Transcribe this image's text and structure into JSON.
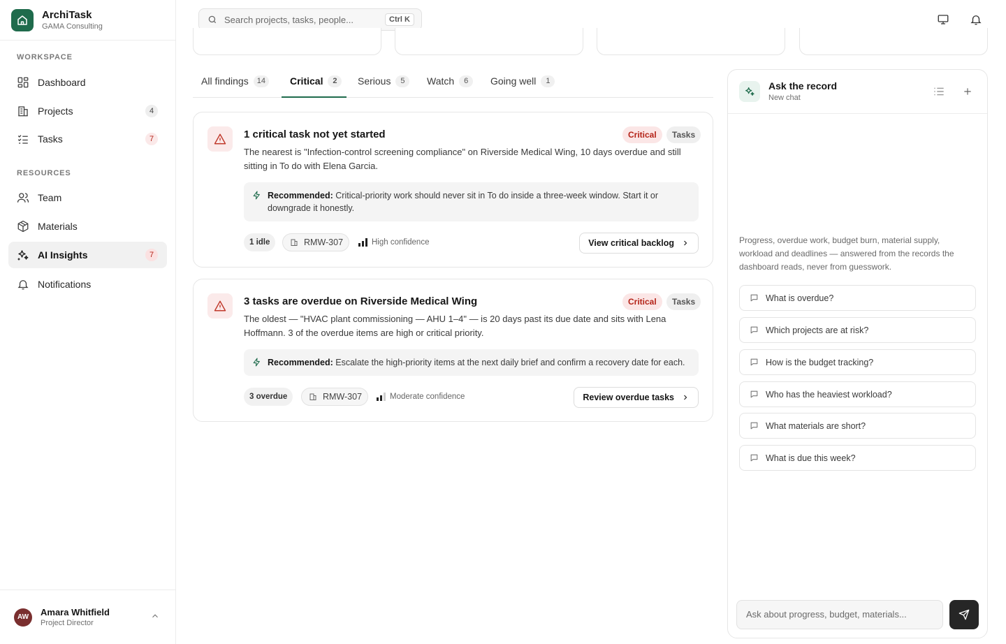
{
  "app": {
    "name": "ArchiTask",
    "org": "GAMA Consulting"
  },
  "sidebar": {
    "workspace_label": "WORKSPACE",
    "resources_label": "RESOURCES",
    "items": [
      {
        "label": "Dashboard",
        "icon": "dashboard-icon",
        "count": ""
      },
      {
        "label": "Projects",
        "icon": "building-icon",
        "count": "4"
      },
      {
        "label": "Tasks",
        "icon": "list-check-icon",
        "count": "7"
      },
      {
        "label": "Team",
        "icon": "users-icon",
        "count": ""
      },
      {
        "label": "Materials",
        "icon": "package-icon",
        "count": ""
      },
      {
        "label": "AI Insights",
        "icon": "sparkles-icon",
        "count": "7",
        "active": true
      },
      {
        "label": "Notifications",
        "icon": "bell-icon",
        "count": ""
      }
    ]
  },
  "user": {
    "initials": "AW",
    "name": "Amara Whitfield",
    "role": "Project Director"
  },
  "topbar": {
    "search_placeholder": "Search projects, tasks, people...",
    "shortcut": "Ctrl K"
  },
  "tabs": [
    {
      "label": "All findings",
      "count": "14"
    },
    {
      "label": "Critical",
      "count": "2",
      "active": true
    },
    {
      "label": "Serious",
      "count": "5"
    },
    {
      "label": "Watch",
      "count": "6"
    },
    {
      "label": "Going well",
      "count": "1"
    }
  ],
  "findings": [
    {
      "title": "1 critical task not yet started",
      "severity": "Critical",
      "category": "Tasks",
      "body": "The nearest is \"Infection-control screening compliance\" on Riverside Medical Wing, 10 days overdue and still sitting in To do with Elena Garcia.",
      "rec_label": "Recommended:",
      "rec_text": "Critical-priority work should never sit in To do inside a three-week window. Start it or downgrade it honestly.",
      "stat": "1 idle",
      "project_code": "RMW-307",
      "confidence": "High confidence",
      "action": "View critical backlog"
    },
    {
      "title": "3 tasks are overdue on Riverside Medical Wing",
      "severity": "Critical",
      "category": "Tasks",
      "body": "The oldest — \"HVAC plant commissioning — AHU 1–4\" — is 20 days past its due date and sits with Lena Hoffmann. 3 of the overdue items are high or critical priority.",
      "rec_label": "Recommended:",
      "rec_text": "Escalate the high-priority items at the next daily brief and confirm a recovery date for each.",
      "stat": "3 overdue",
      "project_code": "RMW-307",
      "confidence": "Moderate confidence",
      "action": "Review overdue tasks"
    }
  ],
  "chat": {
    "title": "Ask the record",
    "subtitle": "New chat",
    "intro": "Progress, overdue work, budget burn, material supply, workload and deadlines — answered from the records the dashboard reads, never from guesswork.",
    "suggestions": [
      "What is overdue?",
      "Which projects are at risk?",
      "How is the budget tracking?",
      "Who has the heaviest workload?",
      "What materials are short?",
      "What is due this week?"
    ],
    "input_placeholder": "Ask about progress, budget, materials..."
  },
  "colors": {
    "brand": "#1f6b4c",
    "critical": "#b42318",
    "critical_bg": "#fbe6e6"
  }
}
